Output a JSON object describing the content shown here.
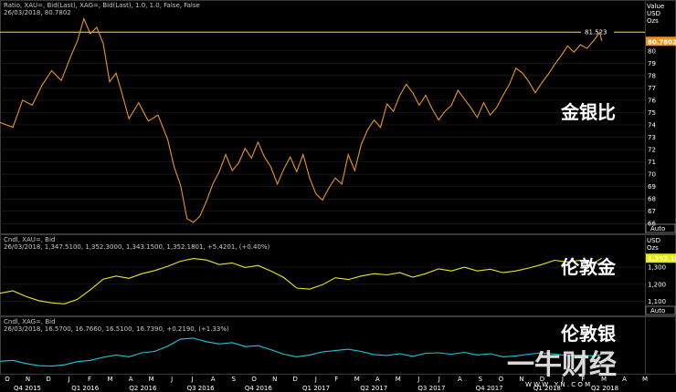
{
  "colors": {
    "ratio": "#e8961e",
    "gold": "#e8e81e",
    "silver": "#1ec8d8",
    "ref_line": "#ffee00",
    "panel_bg": "#000000",
    "grid": "#2a2a2a"
  },
  "watermark": {
    "title": "一牛财经",
    "url": "W W W . Y N . C O M"
  },
  "chart_data": [
    {
      "type": "line",
      "header": [
        "Ratio, XAU=, Bid(Last), XAG=, Bid(Last), 1.0, 1.0, False, False",
        "26/03/2018, 80.7802"
      ],
      "annotation": "金银比",
      "axis_unit": [
        "Value",
        "USD",
        "Ozs"
      ],
      "last_value": "80.7802",
      "ref_value": "81.523",
      "ylim": [
        65.5,
        82.5
      ],
      "y_ticks": [
        66,
        67,
        68,
        69,
        70,
        71,
        72,
        73,
        74,
        75,
        76,
        77,
        78,
        79,
        80
      ],
      "auto_label": "Auto",
      "series": [
        {
          "points": [
            [
              0,
              74.2
            ],
            [
              0.02,
              73.8
            ],
            [
              0.035,
              76
            ],
            [
              0.05,
              75.6
            ],
            [
              0.065,
              77.2
            ],
            [
              0.08,
              78.4
            ],
            [
              0.095,
              77.6
            ],
            [
              0.11,
              79.6
            ],
            [
              0.12,
              80.8
            ],
            [
              0.13,
              82.6
            ],
            [
              0.14,
              81.4
            ],
            [
              0.15,
              81.9
            ],
            [
              0.16,
              80.6
            ],
            [
              0.17,
              77.5
            ],
            [
              0.18,
              78.2
            ],
            [
              0.19,
              76.4
            ],
            [
              0.2,
              74.5
            ],
            [
              0.215,
              75.8
            ],
            [
              0.23,
              74.3
            ],
            [
              0.245,
              74.8
            ],
            [
              0.26,
              72.8
            ],
            [
              0.27,
              70.6
            ],
            [
              0.28,
              69.1
            ],
            [
              0.29,
              66.4
            ],
            [
              0.3,
              66.1
            ],
            [
              0.31,
              66.6
            ],
            [
              0.32,
              67.8
            ],
            [
              0.33,
              69.2
            ],
            [
              0.34,
              70.2
            ],
            [
              0.35,
              71.6
            ],
            [
              0.36,
              70.3
            ],
            [
              0.37,
              70.9
            ],
            [
              0.38,
              72.1
            ],
            [
              0.39,
              71.3
            ],
            [
              0.4,
              72.6
            ],
            [
              0.41,
              71.4
            ],
            [
              0.42,
              70.6
            ],
            [
              0.43,
              69.2
            ],
            [
              0.44,
              70.4
            ],
            [
              0.45,
              71.4
            ],
            [
              0.46,
              70.2
            ],
            [
              0.47,
              71.6
            ],
            [
              0.48,
              69.7
            ],
            [
              0.49,
              68.4
            ],
            [
              0.5,
              67.9
            ],
            [
              0.51,
              68.9
            ],
            [
              0.52,
              69.7
            ],
            [
              0.53,
              69.2
            ],
            [
              0.54,
              71.6
            ],
            [
              0.55,
              70.3
            ],
            [
              0.56,
              72.4
            ],
            [
              0.57,
              73.6
            ],
            [
              0.58,
              74.4
            ],
            [
              0.59,
              73.8
            ],
            [
              0.6,
              75.7
            ],
            [
              0.61,
              75.1
            ],
            [
              0.62,
              76.4
            ],
            [
              0.63,
              77.3
            ],
            [
              0.64,
              76.6
            ],
            [
              0.65,
              75.6
            ],
            [
              0.66,
              76.4
            ],
            [
              0.67,
              75.3
            ],
            [
              0.68,
              74.4
            ],
            [
              0.69,
              75.1
            ],
            [
              0.7,
              75.6
            ],
            [
              0.71,
              76.8
            ],
            [
              0.72,
              76.1
            ],
            [
              0.73,
              75.4
            ],
            [
              0.74,
              74.6
            ],
            [
              0.75,
              75.8
            ],
            [
              0.76,
              74.8
            ],
            [
              0.77,
              75.4
            ],
            [
              0.78,
              76.4
            ],
            [
              0.79,
              77.3
            ],
            [
              0.8,
              78.6
            ],
            [
              0.81,
              78.2
            ],
            [
              0.82,
              77.5
            ],
            [
              0.83,
              76.6
            ],
            [
              0.84,
              77.4
            ],
            [
              0.85,
              78.1
            ],
            [
              0.86,
              78.9
            ],
            [
              0.87,
              79.6
            ],
            [
              0.88,
              80.4
            ],
            [
              0.89,
              79.9
            ],
            [
              0.9,
              80.5
            ],
            [
              0.91,
              80.2
            ],
            [
              0.92,
              80.8
            ],
            [
              0.93,
              81.5
            ],
            [
              0.933,
              80.8
            ]
          ]
        }
      ]
    },
    {
      "type": "line",
      "header": [
        "Cndl, XAU=, Bid",
        "26/03/2018, 1,347.5100, 1,352.3000, 1,343.1500, 1,352.1801, +5.4201, (+0.40%)"
      ],
      "annotation": "伦敦金",
      "axis_unit": [
        "USD",
        "Ozs"
      ],
      "last_value": "1,352.18",
      "ylim": [
        1040,
        1380
      ],
      "y_ticks": [
        {
          "v": 1100,
          "label": "1,100"
        },
        {
          "v": 1200,
          "label": "1,200"
        },
        {
          "v": 1300,
          "label": "1,300"
        }
      ],
      "auto_label": "Auto",
      "series": [
        {
          "points": [
            [
              0,
              1148
            ],
            [
              0.02,
              1162
            ],
            [
              0.04,
              1130
            ],
            [
              0.06,
              1105
            ],
            [
              0.08,
              1092
            ],
            [
              0.1,
              1086
            ],
            [
              0.12,
              1112
            ],
            [
              0.14,
              1168
            ],
            [
              0.16,
              1230
            ],
            [
              0.18,
              1248
            ],
            [
              0.2,
              1235
            ],
            [
              0.22,
              1262
            ],
            [
              0.24,
              1280
            ],
            [
              0.26,
              1305
            ],
            [
              0.28,
              1335
            ],
            [
              0.3,
              1350
            ],
            [
              0.32,
              1342
            ],
            [
              0.34,
              1315
            ],
            [
              0.36,
              1325
            ],
            [
              0.38,
              1298
            ],
            [
              0.4,
              1310
            ],
            [
              0.42,
              1278
            ],
            [
              0.44,
              1240
            ],
            [
              0.46,
              1178
            ],
            [
              0.48,
              1172
            ],
            [
              0.5,
              1198
            ],
            [
              0.52,
              1238
            ],
            [
              0.54,
              1228
            ],
            [
              0.56,
              1248
            ],
            [
              0.58,
              1262
            ],
            [
              0.6,
              1255
            ],
            [
              0.62,
              1268
            ],
            [
              0.64,
              1242
            ],
            [
              0.66,
              1262
            ],
            [
              0.68,
              1290
            ],
            [
              0.7,
              1278
            ],
            [
              0.72,
              1300
            ],
            [
              0.74,
              1278
            ],
            [
              0.76,
              1288
            ],
            [
              0.78,
              1268
            ],
            [
              0.8,
              1278
            ],
            [
              0.82,
              1295
            ],
            [
              0.84,
              1315
            ],
            [
              0.86,
              1340
            ],
            [
              0.88,
              1330
            ],
            [
              0.9,
              1340
            ],
            [
              0.92,
              1322
            ],
            [
              0.933,
              1352
            ]
          ]
        }
      ]
    },
    {
      "type": "line",
      "header": [
        "Cndl, XAG=, Bid",
        "26/03/2018, 16.5700, 16.7660, 16.5100, 16.7390, +0.2190, (+1.33%)"
      ],
      "annotation": "伦敦银",
      "ylim": [
        13.2,
        21
      ],
      "x_ticks": [
        "O",
        "N",
        "D",
        "J",
        "F",
        "M",
        "A",
        "M",
        "J",
        "J",
        "A",
        "S",
        "O",
        "N",
        "D",
        "J",
        "F",
        "M",
        "A",
        "M",
        "J",
        "J",
        "A",
        "S",
        "O",
        "N",
        "D",
        "J",
        "F",
        "M",
        "A",
        "M"
      ],
      "x_quarters": [
        "Q4 2015",
        "Q1 2016",
        "Q2 2016",
        "Q3 2016",
        "Q4 2016",
        "Q1 2017",
        "Q2 2017",
        "Q3 2017",
        "Q4 2017",
        "Q1 2018",
        "Q2 2018"
      ],
      "series": [
        {
          "points": [
            [
              0,
              15.2
            ],
            [
              0.02,
              15.4
            ],
            [
              0.04,
              14.7
            ],
            [
              0.06,
              14.2
            ],
            [
              0.08,
              14.1
            ],
            [
              0.1,
              14.4
            ],
            [
              0.12,
              15.1
            ],
            [
              0.14,
              15.4
            ],
            [
              0.16,
              16.1
            ],
            [
              0.18,
              16.6
            ],
            [
              0.2,
              16.2
            ],
            [
              0.22,
              17.1
            ],
            [
              0.24,
              17.4
            ],
            [
              0.26,
              18.6
            ],
            [
              0.28,
              20.2
            ],
            [
              0.3,
              20.4
            ],
            [
              0.32,
              19.6
            ],
            [
              0.34,
              19.1
            ],
            [
              0.36,
              19.4
            ],
            [
              0.38,
              18.5
            ],
            [
              0.4,
              18.7
            ],
            [
              0.42,
              17.8
            ],
            [
              0.44,
              16.8
            ],
            [
              0.46,
              16.2
            ],
            [
              0.48,
              16.6
            ],
            [
              0.5,
              17.3
            ],
            [
              0.52,
              17.6
            ],
            [
              0.54,
              17.9
            ],
            [
              0.56,
              17.4
            ],
            [
              0.58,
              16.7
            ],
            [
              0.6,
              16.5
            ],
            [
              0.62,
              16.9
            ],
            [
              0.64,
              16.3
            ],
            [
              0.66,
              17.0
            ],
            [
              0.68,
              17.1
            ],
            [
              0.7,
              16.8
            ],
            [
              0.72,
              17.2
            ],
            [
              0.74,
              16.6
            ],
            [
              0.76,
              16.9
            ],
            [
              0.78,
              16.2
            ],
            [
              0.8,
              16.4
            ],
            [
              0.82,
              16.8
            ],
            [
              0.84,
              17.1
            ],
            [
              0.86,
              16.8
            ],
            [
              0.88,
              16.5
            ],
            [
              0.9,
              16.6
            ],
            [
              0.92,
              16.4
            ],
            [
              0.933,
              16.74
            ]
          ]
        }
      ]
    }
  ]
}
